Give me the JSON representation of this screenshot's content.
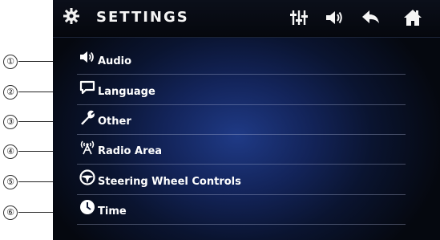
{
  "callouts": [
    "①",
    "②",
    "③",
    "④",
    "⑤",
    "⑥"
  ],
  "header": {
    "title": "SETTINGS",
    "icons": [
      "gear-icon",
      "equalizer-icon",
      "volume-icon",
      "back-icon",
      "home-icon"
    ]
  },
  "menu": {
    "items": [
      {
        "label": "Audio",
        "icon": "speaker-icon"
      },
      {
        "label": "Language",
        "icon": "speech-bubble-icon"
      },
      {
        "label": "Other",
        "icon": "wrench-icon"
      },
      {
        "label": "Radio Area",
        "icon": "antenna-icon"
      },
      {
        "label": "Steering Wheel Controls",
        "icon": "steering-wheel-icon"
      },
      {
        "label": "Time",
        "icon": "clock-icon"
      }
    ]
  },
  "colors": {
    "background": "#0a1430",
    "accent": "#1f3a86",
    "text": "#ffffff"
  }
}
